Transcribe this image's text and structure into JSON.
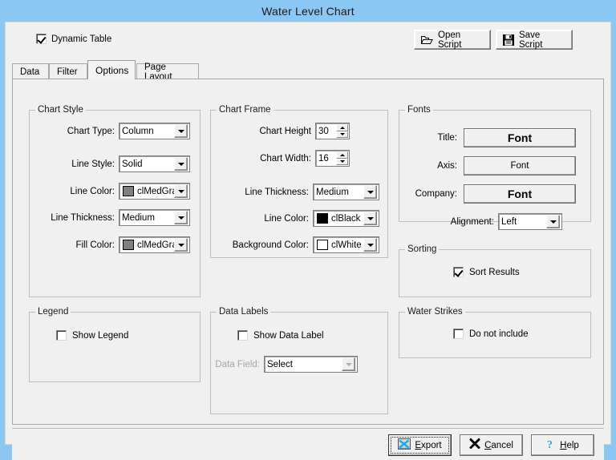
{
  "window": {
    "title": "Water Level Chart"
  },
  "toolbar": {
    "dynamic_table_label": "Dynamic Table",
    "dynamic_table_checked": true,
    "open_script_label": "Open Script",
    "save_script_label": "Save Script"
  },
  "tabs": [
    {
      "label": "Data",
      "active": false
    },
    {
      "label": "Filter",
      "active": false
    },
    {
      "label": "Options",
      "active": true
    },
    {
      "label": "Page Layout",
      "active": false
    }
  ],
  "chart_style": {
    "caption": "Chart Style",
    "chart_type": {
      "label": "Chart Type:",
      "value": "Column"
    },
    "line_style": {
      "label": "Line Style:",
      "value": "Solid"
    },
    "line_color": {
      "label": "Line Color:",
      "value": "clMedGra",
      "swatch": "#808080"
    },
    "line_thickness": {
      "label": "Line Thickness:",
      "value": "Medium"
    },
    "fill_color": {
      "label": "Fill Color:",
      "value": "clMedGra",
      "swatch": "#808080"
    }
  },
  "chart_frame": {
    "caption": "Chart Frame",
    "chart_height": {
      "label": "Chart Height",
      "value": "30"
    },
    "chart_width": {
      "label": "Chart Width:",
      "value": "16"
    },
    "line_thickness": {
      "label": "Line Thickness:",
      "value": "Medium"
    },
    "line_color": {
      "label": "Line Color:",
      "value": "clBlack",
      "swatch": "#000000"
    },
    "background_color": {
      "label": "Background Color:",
      "value": "clWhite",
      "swatch": "#ffffff"
    }
  },
  "fonts": {
    "caption": "Fonts",
    "title": {
      "label": "Title:",
      "button": "Font"
    },
    "axis": {
      "label": "Axis:",
      "button": "Font"
    },
    "company": {
      "label": "Company:",
      "button": "Font"
    },
    "alignment": {
      "label": "Alignment:",
      "value": "Left"
    }
  },
  "sorting": {
    "caption": "Sorting",
    "sort_results_label": "Sort Results",
    "sort_results_checked": true
  },
  "water_strikes": {
    "caption": "Water Strikes",
    "do_not_include_label": "Do not include",
    "do_not_include_checked": false
  },
  "legend": {
    "caption": "Legend",
    "show_legend_label": "Show Legend",
    "show_legend_checked": false
  },
  "data_labels": {
    "caption": "Data Labels",
    "show_data_label": "Show Data Label",
    "show_data_label_checked": false,
    "data_field_label": "Data Field:",
    "data_field_value": "Select"
  },
  "footer": {
    "export_label": "Export",
    "cancel_label": "Cancel",
    "help_label": "Help"
  },
  "colors": {
    "titlebar": "#8cc6f2",
    "dialog_face": "#f0f0f0"
  }
}
